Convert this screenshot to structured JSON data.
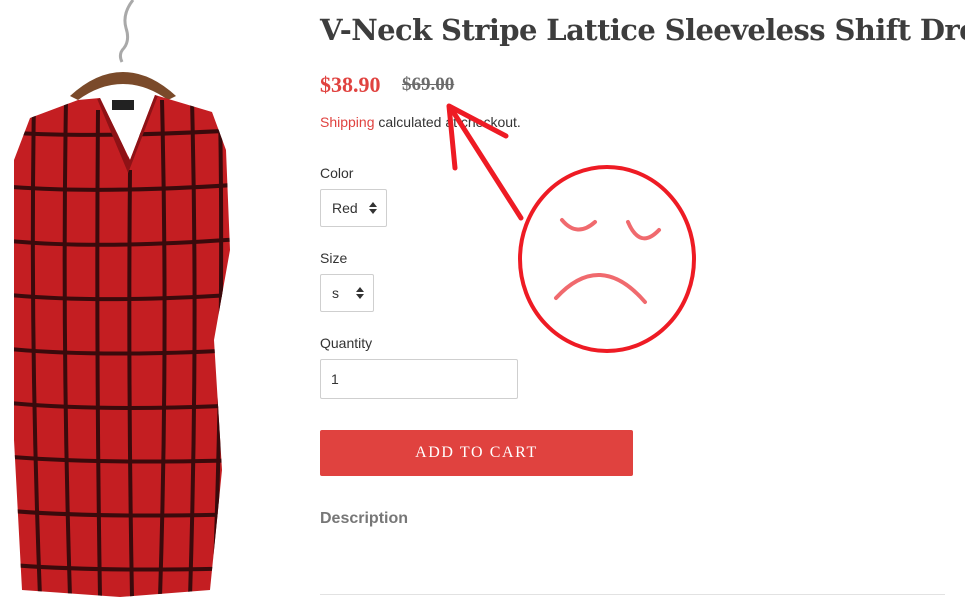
{
  "product": {
    "title": "V-Neck Stripe Lattice Sleeveless Shift Dress",
    "image_alt": "Red dress with black grid lattice pattern on a wooden hanger",
    "price_sale": "$38.90",
    "price_compare": "$69.00"
  },
  "shipping": {
    "link_text": "Shipping",
    "rest_text": " calculated at checkout."
  },
  "options": {
    "color_label": "Color",
    "color_value": "Red",
    "size_label": "Size",
    "size_value": "s",
    "quantity_label": "Quantity",
    "quantity_value": "1"
  },
  "actions": {
    "add_to_cart_label": "ADD TO CART"
  },
  "description": {
    "heading": "Description"
  },
  "colors": {
    "accent": "#e0423f",
    "annotation": "#ee1b24",
    "dress_red": "#c41e22",
    "grid_line": "#3a0a0c"
  },
  "annotation": {
    "arrow_target": "price-compare",
    "face": "sad-face"
  }
}
